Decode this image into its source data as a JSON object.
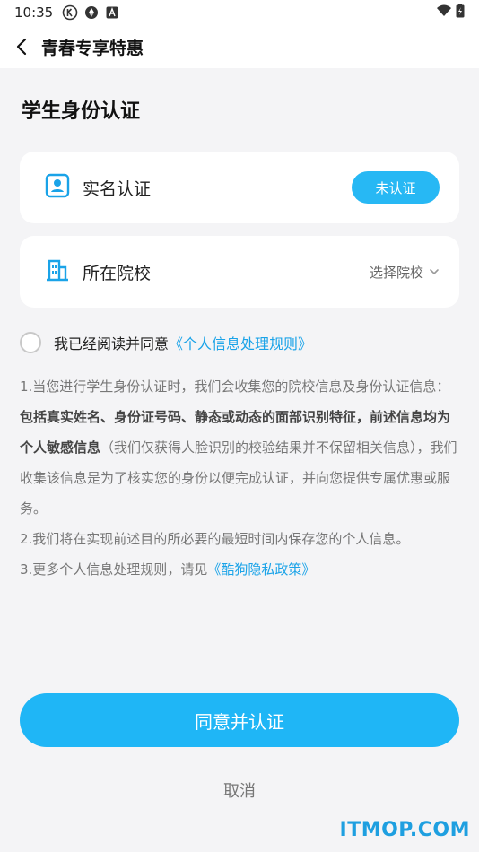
{
  "status_bar": {
    "time": "10:35"
  },
  "app_bar": {
    "title": "青春专享特惠"
  },
  "section": {
    "title": "学生身份认证"
  },
  "realname_card": {
    "label": "实名认证",
    "badge": "未认证"
  },
  "school_card": {
    "label": "所在院校",
    "select_label": "选择院校"
  },
  "agreement": {
    "prefix": "我已经阅读并同意",
    "link": "《个人信息处理规则》"
  },
  "notice": {
    "p1_start": "1.当您进行学生身份认证时，我们会收集您的院校信息及身份认证信息：",
    "p1_bold": "包括真实姓名、身份证号码、静态或动态的面部识别特征，前述信息均为个人敏感信息",
    "p1_end": "（我们仅获得人脸识别的校验结果并不保留相关信息），我们收集该信息是为了核实您的身份以便完成认证，并向您提供专属优惠或服务。",
    "p2": "2.我们将在实现前述目的所必要的最短时间内保存您的个人信息。",
    "p3_start": "3.更多个人信息处理规则，请见",
    "p3_link": "《酷狗隐私政策》"
  },
  "actions": {
    "primary": "同意并认证",
    "cancel": "取消"
  },
  "watermark": "ITMOP.COM",
  "colors": {
    "accent": "#1fb6f6",
    "link": "#1aa3e8",
    "background": "#f4f4f6"
  }
}
